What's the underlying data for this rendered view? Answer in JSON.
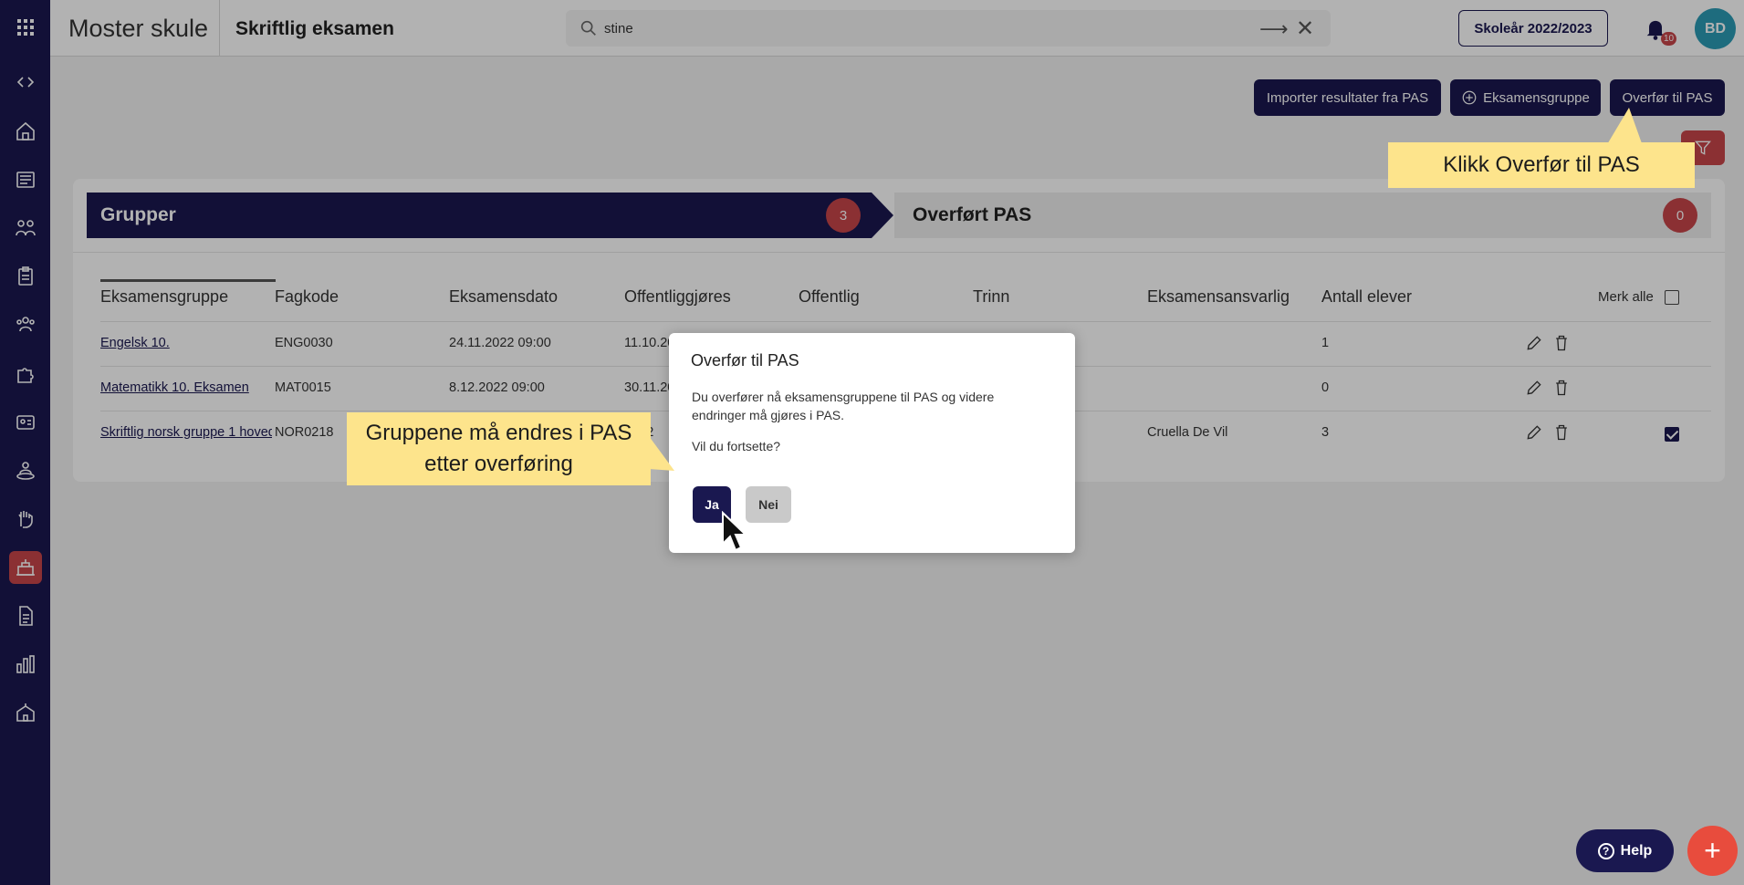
{
  "app": {
    "school_name": "Moster skule",
    "module_title": "Skriftlig eksamen",
    "school_year_button": "Skoleår 2022/2023",
    "notification_count": "10",
    "avatar_initials": "BD"
  },
  "search": {
    "value": "stine",
    "placeholder": ""
  },
  "sidebar": {
    "icons": [
      "apps-grid-icon",
      "expand-collapse-icon",
      "home-icon",
      "news-icon",
      "groups-icon",
      "clipboard-icon",
      "people-icon",
      "puzzle-icon",
      "id-card-icon",
      "presenter-icon",
      "hand-icon",
      "exam-icon",
      "document-icon",
      "statistics-icon",
      "school-icon"
    ],
    "active": "exam-icon"
  },
  "actions": {
    "import_label": "Importer resultater fra PAS",
    "group_label": "Eksamensgruppe",
    "transfer_label": "Overfør til PAS"
  },
  "steps": {
    "left_label": "Grupper",
    "left_count": "3",
    "right_label": "Overført PAS",
    "right_count": "0"
  },
  "table": {
    "headers": [
      "Eksamensgruppe",
      "Fagkode",
      "Eksamensdato",
      "Offentliggjøres",
      "Offentlig",
      "Trinn",
      "Eksamensansvarlig",
      "Antall elever"
    ],
    "select_all_label": "Merk alle",
    "rows": [
      {
        "group": "Engelsk 10.",
        "code": "ENG0030",
        "date": "24.11.2022 09:00",
        "published": "11.10.2022",
        "responsible": "",
        "students": "1",
        "checked": false
      },
      {
        "group": "Matematikk 10. Eksamen",
        "code": "MAT0015",
        "date": "8.12.2022 09:00",
        "published": "30.11.2022",
        "responsible": "",
        "students": "0",
        "checked": false
      },
      {
        "group": "Skriftlig norsk gruppe 1 hovedmål",
        "code": "NOR0218",
        "date": "",
        "published": "2022",
        "responsible": "Cruella De Vil",
        "students": "3",
        "checked": true
      }
    ]
  },
  "dialog": {
    "title": "Overfør til PAS",
    "body": "Du overfører nå eksamensgruppene til PAS og videre endringer må gjøres i PAS.",
    "question": "Vil du fortsette?",
    "yes_label": "Ja",
    "no_label": "Nei"
  },
  "callouts": {
    "transfer_hint": "Klikk Overfør til PAS",
    "groups_hint_line1": "Gruppene må endres i PAS",
    "groups_hint_line2": "etter overføring"
  },
  "help": {
    "label": "Help",
    "fab_symbol": "+"
  },
  "colors": {
    "navy": "#1a1850",
    "red": "#c8454a",
    "callout": "#fde48c",
    "avatar": "#2b9bb5"
  }
}
